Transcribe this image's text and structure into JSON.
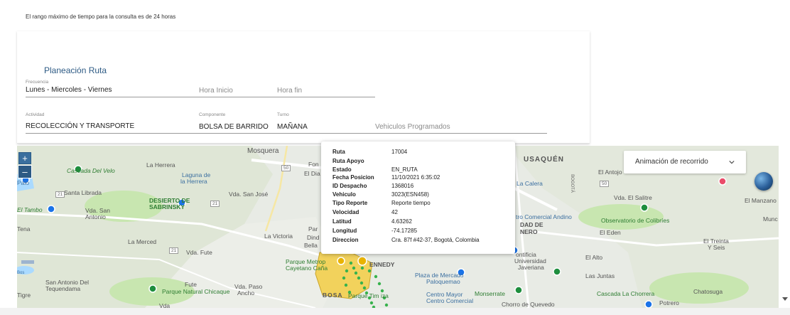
{
  "notice": "El rango máximo de tiempo para la consulta es de 24 horas",
  "planning": {
    "title": "Planeación Ruta",
    "frequency": {
      "label": "Frecuencia",
      "value": "Lunes - Miercoles - Viernes"
    },
    "start_time": {
      "placeholder": "Hora Inicio"
    },
    "end_time": {
      "placeholder": "Hora fin"
    },
    "activity": {
      "label": "Actividad",
      "value": "RECOLECCIÓN Y TRANSPORTE"
    },
    "component": {
      "label": "Componente",
      "value": "BOLSA DE BARRIDO"
    },
    "shift": {
      "label": "Turno",
      "value": "MAÑANA"
    },
    "vehicles": {
      "placeholder": "Vehiculos Programados"
    }
  },
  "map": {
    "zoom_in": "+",
    "zoom_out": "–",
    "animation_dropdown": {
      "label": "Animación de recorrido"
    },
    "places": [
      "Mosquera",
      "USAQUÉN",
      "La Herrera",
      "Cascada Del Velo",
      "Laguna de",
      "la Herrera",
      "El Dia",
      "Fon",
      "El Antojo",
      "La Calera",
      "BOGOTÁ",
      "Santa Librada",
      "Vda. San José",
      "DESIERTO DE",
      "SABRINSKY",
      "El Tambo",
      "Vda. San",
      "Antonio",
      "Vda. El Salitre",
      "El Manzano",
      "Tena",
      "tro Comercial Andino",
      "DAD DE",
      "NERO",
      "Observatorio de Colibríes",
      "Munc",
      "La Victoria",
      "Par",
      "Dind",
      "Bella",
      "El Eden",
      "El Treinta",
      "Y Seis",
      "La Merced",
      "Vda. Fute",
      "Parque Metrop",
      "Cayetano Caña",
      "ENNEDY",
      "ontificia",
      "Universidad",
      "Javeriana",
      "El Alto",
      "Plaza de Mercado",
      "Paloquemao",
      "Las Juntas",
      "San Antonio Del",
      "Tequendama",
      "Fute",
      "Vda. Paso",
      "Ancho",
      "Parque Natural Chicaque",
      "BOSA",
      "Parque Tim",
      "iza",
      "Centro Mayor",
      "Centro Comercial",
      "Monserrate",
      "Cascada La Chorrera",
      "Chatosuga",
      "Potrero",
      "Tigre",
      "Vda",
      "Palo",
      "Bos",
      "Chorro de Quevedo"
    ],
    "road_numbers": [
      "50",
      "21",
      "21",
      "21",
      "50"
    ]
  },
  "popup": {
    "rows": [
      {
        "key": "Ruta",
        "value": "17004"
      },
      {
        "key": "Ruta Apoyo",
        "value": ""
      },
      {
        "key": "Estado",
        "value": "EN_RUTA"
      },
      {
        "key": "Fecha Posicion",
        "value": "11/10/2021 6:35:02"
      },
      {
        "key": "ID Despacho",
        "value": "1368016"
      },
      {
        "key": "Vehiculo",
        "value": "3023(ESN458)"
      },
      {
        "key": "Tipo Reporte",
        "value": "Reporte tiempo"
      },
      {
        "key": "Velocidad",
        "value": "42"
      },
      {
        "key": "Latitud",
        "value": "4.63262"
      },
      {
        "key": "Longitud",
        "value": "-74.17285"
      },
      {
        "key": "Direccion",
        "value": "Cra. 87f #42-37, Bogotá, Colombia"
      }
    ]
  },
  "colors": {
    "accent": "#2d5a84",
    "route_points": "#37b24d",
    "zone_fill": "#f2d25c",
    "water": "#aadaff",
    "park": "#c8e6b0",
    "map_bg": "#e8ebe5"
  }
}
